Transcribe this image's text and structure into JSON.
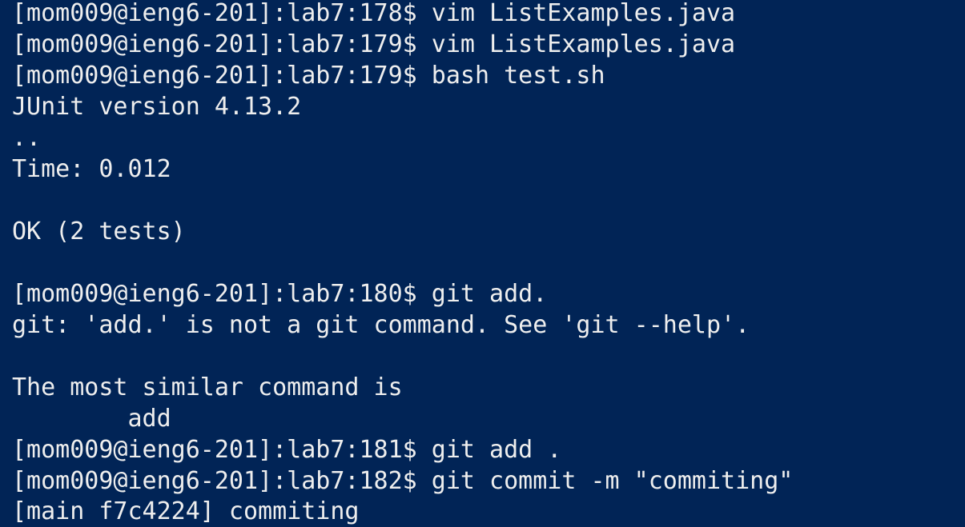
{
  "terminal": {
    "lines": [
      "[mom009@ieng6-201]:lab7:178$ vim ListExamples.java",
      "[mom009@ieng6-201]:lab7:179$ vim ListExamples.java",
      "[mom009@ieng6-201]:lab7:179$ bash test.sh",
      "JUnit version 4.13.2",
      "..",
      "Time: 0.012",
      "",
      "OK (2 tests)",
      "",
      "[mom009@ieng6-201]:lab7:180$ git add.",
      "git: 'add.' is not a git command. See 'git --help'.",
      "",
      "The most similar command is",
      "        add",
      "[mom009@ieng6-201]:lab7:181$ git add .",
      "[mom009@ieng6-201]:lab7:182$ git commit -m \"commiting\"",
      "[main f7c4224] commiting"
    ],
    "colors": {
      "background": "#012456",
      "foreground": "#eeeeee"
    }
  }
}
